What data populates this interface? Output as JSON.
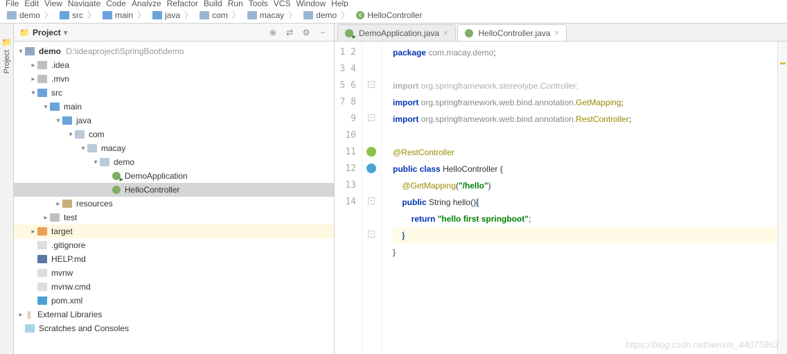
{
  "menu": [
    "File",
    "Edit",
    "View",
    "Navigate",
    "Code",
    "Analyze",
    "Refactor",
    "Build",
    "Run",
    "Tools",
    "VCS",
    "Window",
    "Help"
  ],
  "breadcrumbs": [
    {
      "icon": "folder-module",
      "label": "demo"
    },
    {
      "icon": "folder-blue",
      "label": "src"
    },
    {
      "icon": "folder-blue",
      "label": "main"
    },
    {
      "icon": "folder-blue",
      "label": "java"
    },
    {
      "icon": "folder",
      "label": "com"
    },
    {
      "icon": "folder",
      "label": "macay"
    },
    {
      "icon": "folder",
      "label": "demo"
    },
    {
      "icon": "class",
      "label": "HelloController"
    }
  ],
  "project": {
    "title": "Project",
    "root_label": "demo",
    "root_path": "D:\\ideaproject\\SpringBoot\\demo",
    "children": [
      {
        "d": 1,
        "a": ">",
        "i": "folder-grey",
        "l": ".idea"
      },
      {
        "d": 1,
        "a": ">",
        "i": "folder-grey",
        "l": ".mvn"
      },
      {
        "d": 1,
        "a": "v",
        "i": "folder-blue",
        "l": "src"
      },
      {
        "d": 2,
        "a": "v",
        "i": "folder-blue",
        "l": "main"
      },
      {
        "d": 3,
        "a": "v",
        "i": "folder-blue",
        "l": "java"
      },
      {
        "d": 4,
        "a": "v",
        "i": "folder",
        "l": "com"
      },
      {
        "d": 5,
        "a": "v",
        "i": "folder",
        "l": "macay"
      },
      {
        "d": 6,
        "a": "v",
        "i": "folder",
        "l": "demo"
      },
      {
        "d": 7,
        "a": "",
        "i": "class-main",
        "l": "DemoApplication"
      },
      {
        "d": 7,
        "a": "",
        "i": "class",
        "l": "HelloController",
        "sel": true
      },
      {
        "d": 3,
        "a": ">",
        "i": "folder-res",
        "l": "resources"
      },
      {
        "d": 2,
        "a": ">",
        "i": "folder-grey",
        "l": "test"
      },
      {
        "d": 1,
        "a": ">",
        "i": "folder-orange",
        "l": "target",
        "hl": "target"
      },
      {
        "d": 1,
        "a": "",
        "i": "file",
        "l": ".gitignore"
      },
      {
        "d": 1,
        "a": "",
        "i": "md",
        "l": "HELP.md"
      },
      {
        "d": 1,
        "a": "",
        "i": "file",
        "l": "mvnw"
      },
      {
        "d": 1,
        "a": "",
        "i": "file",
        "l": "mvnw.cmd"
      },
      {
        "d": 1,
        "a": "",
        "i": "xml",
        "l": "pom.xml"
      }
    ],
    "ext_lib": "External Libraries",
    "scratch": "Scratches and Consoles"
  },
  "tabs": [
    {
      "icon": "class-main",
      "label": "DemoApplication.java",
      "active": false
    },
    {
      "icon": "class",
      "label": "HelloController.java",
      "active": true
    }
  ],
  "code": {
    "lines": [
      {
        "n": 1,
        "html": "<span class='kw'>package</span> <span class='pkg'>com.macay.demo</span>;"
      },
      {
        "n": 2,
        "html": ""
      },
      {
        "n": 3,
        "html": "<span class='grey-import'><span class='kw' style='color:#b0b0b0'>import</span> org.springframework.stereotype.Controller;</span>",
        "fold": "-"
      },
      {
        "n": 4,
        "html": "<span class='kw'>import</span> <span class='pkg'>org.springframework.web.bind.annotation.</span><span class='ann'>GetMapping</span>;"
      },
      {
        "n": 5,
        "html": "<span class='kw'>import</span> <span class='pkg'>org.springframework.web.bind.annotation.</span><span class='ann'>RestController</span>;",
        "fold": "-"
      },
      {
        "n": 6,
        "html": ""
      },
      {
        "n": 7,
        "html": "<span class='ann'>@RestController</span>",
        "marker": "green"
      },
      {
        "n": 8,
        "html": "<span class='kw'>public</span> <span class='kw'>class</span> <span class='cl'>HelloController</span> {",
        "marker": "teal"
      },
      {
        "n": 9,
        "html": "    <span class='ann'>@GetMapping</span>(<span class='str'>\"/hello\"</span>)"
      },
      {
        "n": 10,
        "html": "    <span class='kw'>public</span> <span class='id'>String</span> <span class='fn'>hello</span>()<span class='sel-brace'>{</span>",
        "fold": "-"
      },
      {
        "n": 11,
        "html": "        <span class='kw'>return</span> <span class='str'>\"hello first springboot\"</span>;"
      },
      {
        "n": 12,
        "html": "<span class='hl-line'>    <span class='sel-brace'>}</span></span>",
        "fold": "-"
      },
      {
        "n": 13,
        "html": "}"
      },
      {
        "n": 14,
        "html": ""
      }
    ]
  },
  "watermark": "https://blog.csdn.net/weixin_44075963",
  "sidetab": {
    "label": "Project",
    "glyph": "⬚"
  }
}
